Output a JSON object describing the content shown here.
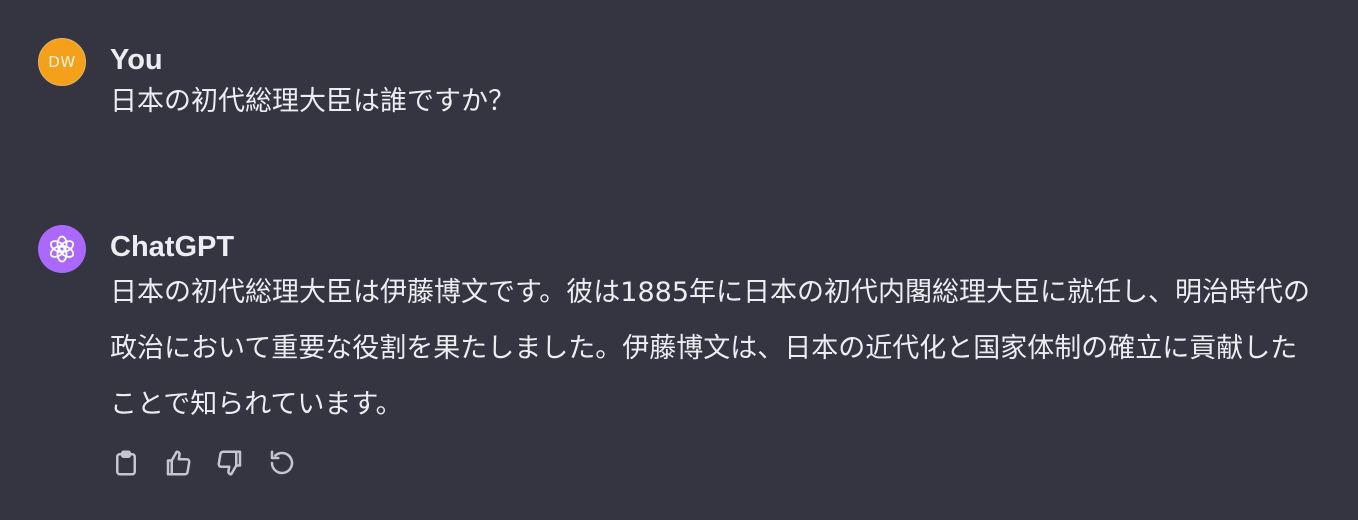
{
  "conversation": {
    "user": {
      "avatar_initials": "DW",
      "name": "You",
      "message": "日本の初代総理大臣は誰ですか？"
    },
    "assistant": {
      "name": "ChatGPT",
      "message": "日本の初代総理大臣は伊藤博文です。彼は1885年に日本の初代内閣総理大臣に就任し、明治時代の政治において重要な役割を果たしました。伊藤博文は、日本の近代化と国家体制の確立に貢献したことで知られています。",
      "actions": [
        {
          "icon": "clipboard-icon"
        },
        {
          "icon": "thumbs-up-icon"
        },
        {
          "icon": "thumbs-down-icon"
        },
        {
          "icon": "regenerate-icon"
        }
      ]
    }
  },
  "colors": {
    "background": "#343541",
    "user_avatar": "#f5a01a",
    "assistant_avatar": "#ab68ff",
    "text": "#ececf1",
    "icon": "#c5c5d2"
  }
}
